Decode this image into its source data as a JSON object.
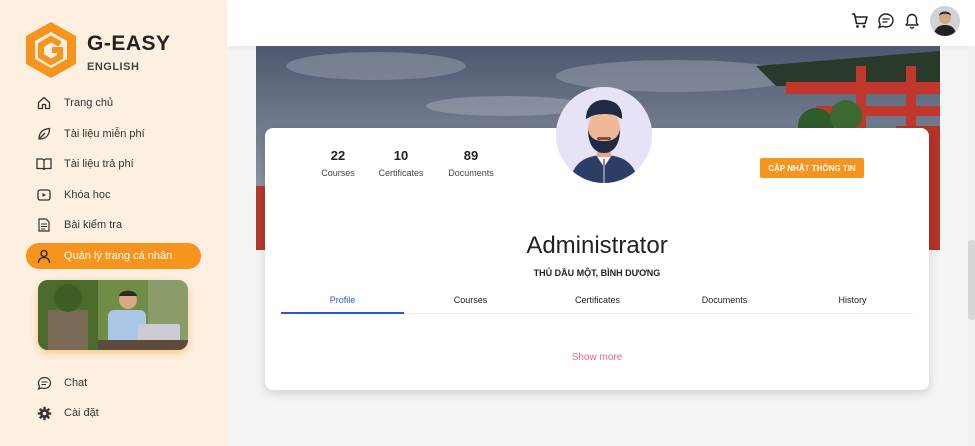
{
  "brand": {
    "name": "G-EASY",
    "sub": "ENGLISH",
    "color": "#f7941d"
  },
  "sidebar": {
    "items": [
      {
        "label": "Trang chủ",
        "icon": "home-icon"
      },
      {
        "label": "Tài liệu miễn phí",
        "icon": "leaf-icon"
      },
      {
        "label": "Tài liệu trả phí",
        "icon": "book-icon"
      },
      {
        "label": "Khóa học",
        "icon": "video-icon"
      },
      {
        "label": "Bài kiểm tra",
        "icon": "document-icon"
      },
      {
        "label": "Quản lý trang cá nhân",
        "icon": "user-icon",
        "active": true
      },
      {
        "label": "Chat",
        "icon": "chat-icon"
      },
      {
        "label": "Cài đặt",
        "icon": "gear-icon"
      }
    ]
  },
  "topbar": {
    "icons": [
      "cart-icon",
      "message-icon",
      "bell-icon",
      "avatar"
    ]
  },
  "profile": {
    "stats": [
      {
        "value": "22",
        "label": "Courses"
      },
      {
        "value": "10",
        "label": "Certificates"
      },
      {
        "value": "89",
        "label": "Documents"
      }
    ],
    "update_button": "CẬP NHẬT THÔNG TIN",
    "name": "Administrator",
    "location": "THỦ DẦU MỘT, BÌNH DƯƠNG",
    "tabs": [
      "Profile",
      "Courses",
      "Certificates",
      "Documents",
      "History"
    ],
    "active_tab": "Profile",
    "show_more": "Show more"
  },
  "colors": {
    "accent": "#f7941d",
    "sidebar_bg": "#fdf0e1",
    "tab_active": "#2f55d4",
    "link": "#e06a8a"
  }
}
